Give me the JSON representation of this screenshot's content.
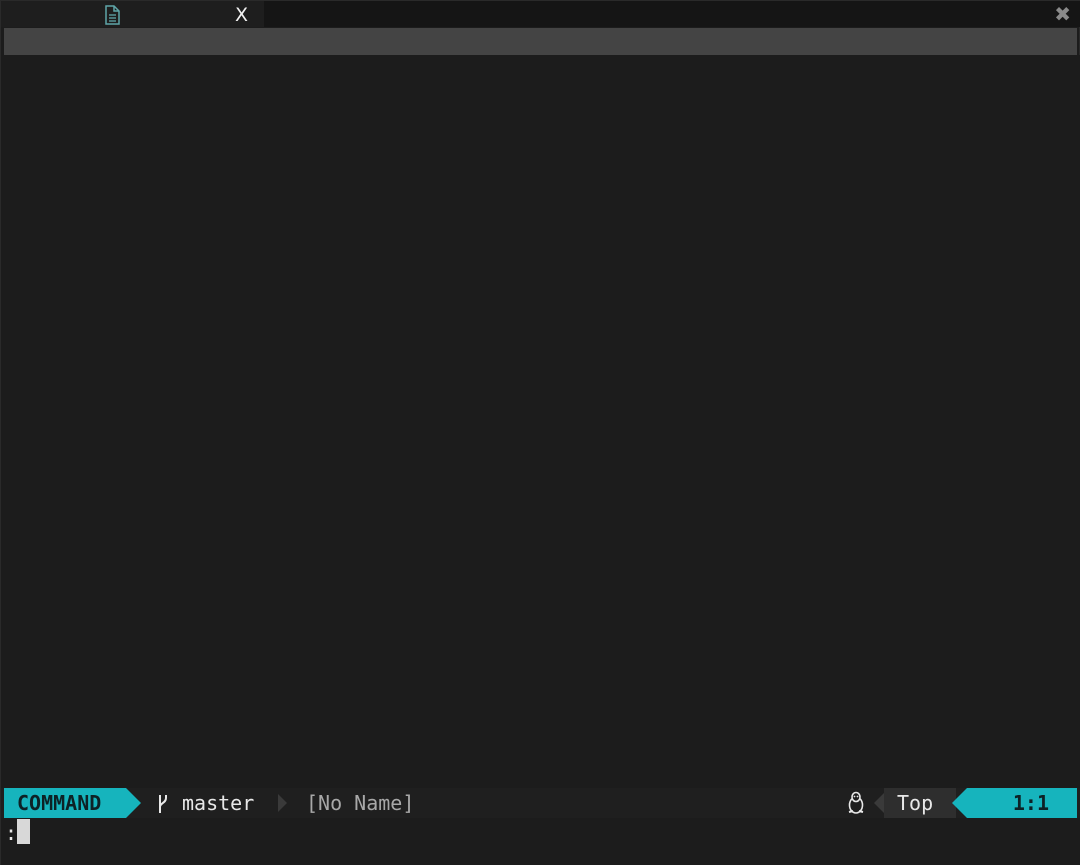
{
  "tabline": {
    "tab_icon": "file-icon",
    "tab_close_label": "X",
    "window_close_label": "✖"
  },
  "statusline": {
    "mode": "COMMAND",
    "branch_icon": "git-branch-icon",
    "branch": "master",
    "file": "[No Name]",
    "os_icon": "linux-penguin-icon",
    "position": "Top",
    "line_col": "1:1"
  },
  "cmdline": {
    "prompt": ":"
  },
  "colors": {
    "accent": "#16b4bd",
    "background": "#1c1c1c",
    "winbar": "#444444"
  }
}
